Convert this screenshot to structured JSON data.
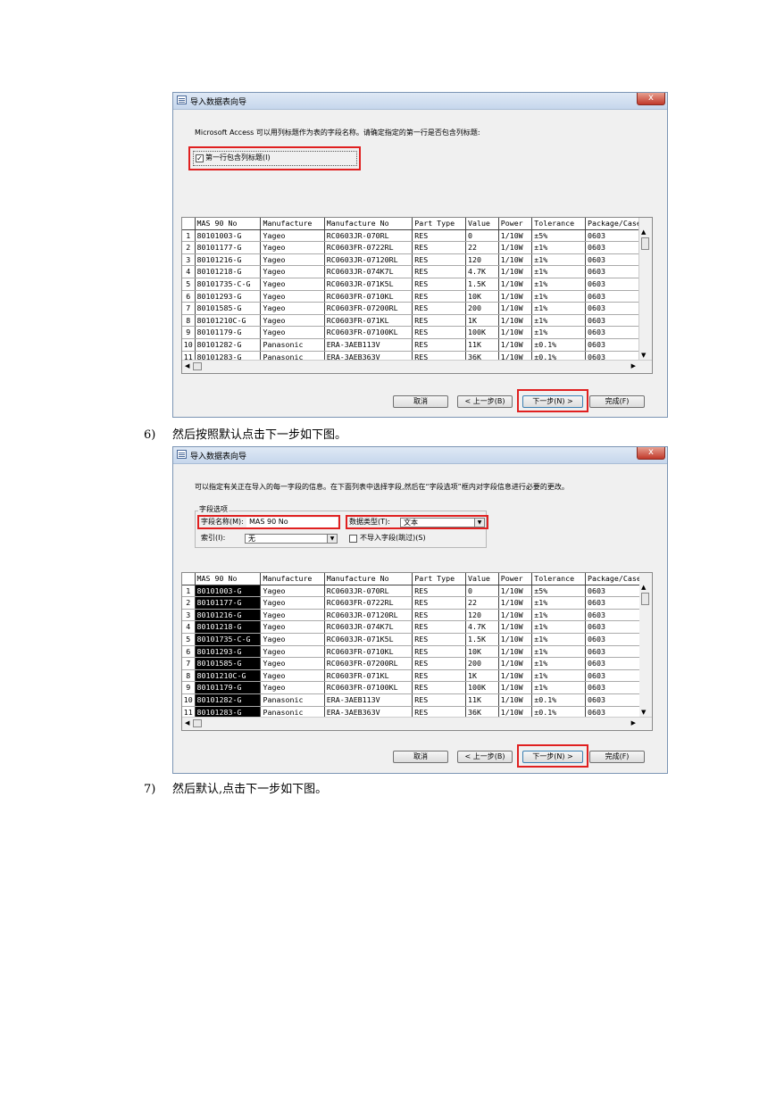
{
  "dialog1": {
    "title": "导入数据表向导",
    "close": "x",
    "instruction": "Microsoft Access 可以用列标题作为表的字段名称。请确定指定的第一行是否包含列标题:",
    "checkbox_mark": "✓",
    "checkbox_label": "第一行包含列标题(I)",
    "buttons": {
      "cancel": "取消",
      "back": "< 上一步(B)",
      "next": "下一步(N) >",
      "finish": "完成(F)"
    }
  },
  "dialog2": {
    "title": "导入数据表向导",
    "close": "x",
    "instruction": "可以指定有关正在导入的每一字段的信息。在下面列表中选择字段,然后在“字段选项”框内对字段信息进行必要的更改。",
    "group_label": "字段选项",
    "field_name_label": "字段名称(M):",
    "field_name_value": "MAS 90 No",
    "data_type_label": "数据类型(T):",
    "data_type_value": "文本",
    "index_label": "索引(I):",
    "index_value": "无",
    "skip_label": "不导入字段(跳过)(S)",
    "buttons": {
      "cancel": "取消",
      "back": "< 上一步(B)",
      "next": "下一步(N) >",
      "finish": "完成(F)"
    }
  },
  "captions": {
    "c6_num": "6)",
    "c6_text": "然后按照默认点击下一步如下图。",
    "c7_num": "7)",
    "c7_text": "然后默认,点击下一步如下图。"
  },
  "table": {
    "headers": [
      "MAS 90 No",
      "Manufacture",
      "Manufacture No",
      "Part Type",
      "Value",
      "Power",
      "Tolerance",
      "Package/Case"
    ],
    "rows": [
      [
        "1",
        "80101003-G",
        "Yageo",
        "RC0603JR-070RL",
        "RES",
        "0",
        "1/10W",
        "±5%",
        "0603"
      ],
      [
        "2",
        "80101177-G",
        "Yageo",
        "RC0603FR-0722RL",
        "RES",
        "22",
        "1/10W",
        "±1%",
        "0603"
      ],
      [
        "3",
        "80101216-G",
        "Yageo",
        "RC0603JR-07120RL",
        "RES",
        "120",
        "1/10W",
        "±1%",
        "0603"
      ],
      [
        "4",
        "80101218-G",
        "Yageo",
        "RC0603JR-074K7L",
        "RES",
        "4.7K",
        "1/10W",
        "±1%",
        "0603"
      ],
      [
        "5",
        "80101735-C-G",
        "Yageo",
        "RC0603JR-071K5L",
        "RES",
        "1.5K",
        "1/10W",
        "±1%",
        "0603"
      ],
      [
        "6",
        "80101293-G",
        "Yageo",
        "RC0603FR-0710KL",
        "RES",
        "10K",
        "1/10W",
        "±1%",
        "0603"
      ],
      [
        "7",
        "80101585-G",
        "Yageo",
        "RC0603FR-07200RL",
        "RES",
        "200",
        "1/10W",
        "±1%",
        "0603"
      ],
      [
        "8",
        "80101210C-G",
        "Yageo",
        "RC0603FR-071KL",
        "RES",
        "1K",
        "1/10W",
        "±1%",
        "0603"
      ],
      [
        "9",
        "80101179-G",
        "Yageo",
        "RC0603FR-07100KL",
        "RES",
        "100K",
        "1/10W",
        "±1%",
        "0603"
      ],
      [
        "10",
        "80101282-G",
        "Panasonic",
        "ERA-3AEB113V",
        "RES",
        "11K",
        "1/10W",
        "±0.1%",
        "0603"
      ],
      [
        "11",
        "80101283-G",
        "Panasonic",
        "ERA-3AEB363V",
        "RES",
        "36K",
        "1/10W",
        "±0.1%",
        "0603"
      ]
    ]
  }
}
